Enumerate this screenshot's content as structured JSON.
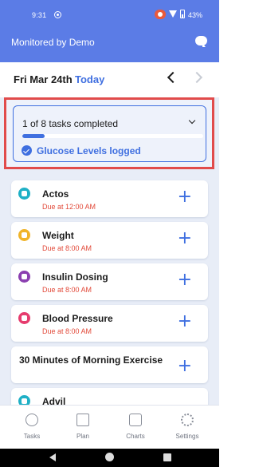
{
  "status_bar": {
    "time": "9:31",
    "battery": "43%"
  },
  "header": {
    "title": "Monitored by Demo",
    "chat_icon": "chat-bubble-icon"
  },
  "date_bar": {
    "date": "Fri Mar 24th",
    "today_label": "Today"
  },
  "progress": {
    "title": "1 of 8 tasks completed",
    "completed": 1,
    "total": 8,
    "logged_label": "Glucose Levels logged"
  },
  "tasks": [
    {
      "name": "Actos",
      "due": "Due at 12:00 AM",
      "color": "#1fb0c6",
      "icon": "pill-icon"
    },
    {
      "name": "Weight",
      "due": "Due at 8:00 AM",
      "color": "#f0b42a",
      "icon": "scale-icon"
    },
    {
      "name": "Insulin Dosing",
      "due": "Due at 8:00 AM",
      "color": "#8b3fb0",
      "icon": "syringe-icon"
    },
    {
      "name": "Blood Pressure",
      "due": "Due at 8:00 AM",
      "color": "#e63c6e",
      "icon": "heart-icon"
    },
    {
      "name": "30 Minutes of Morning Exercise",
      "due": "",
      "color": "",
      "icon": ""
    },
    {
      "name": "Advil",
      "due": "",
      "color": "#1fb0c6",
      "icon": "pill-icon"
    }
  ],
  "add_symbol": "+",
  "bottom_nav": [
    {
      "label": "Tasks",
      "icon": "check-circle-icon"
    },
    {
      "label": "Plan",
      "icon": "clipboard-icon"
    },
    {
      "label": "Charts",
      "icon": "bar-chart-icon"
    },
    {
      "label": "Settings",
      "icon": "gear-icon"
    }
  ],
  "colors": {
    "brand": "#5b7ce6",
    "accent": "#3f6fe0",
    "due": "#e24a3a",
    "highlight": "#e14b4b"
  }
}
